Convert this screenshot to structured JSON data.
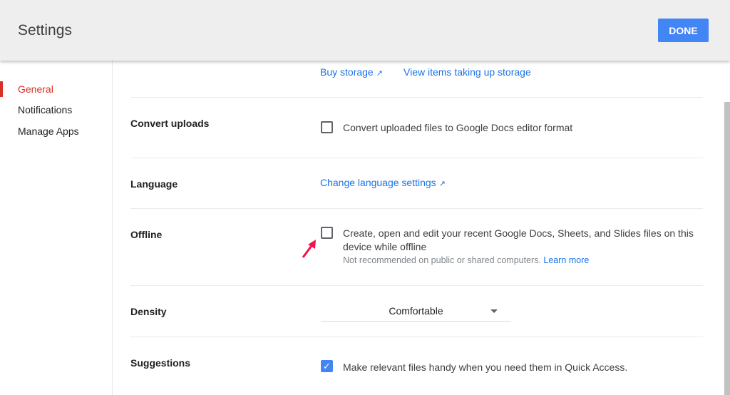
{
  "header": {
    "title": "Settings",
    "done_label": "DONE"
  },
  "sidebar": {
    "items": [
      {
        "label": "General",
        "active": true
      },
      {
        "label": "Notifications"
      },
      {
        "label": "Manage Apps"
      }
    ]
  },
  "storage": {
    "buy_label": "Buy storage",
    "view_label": "View items taking up storage"
  },
  "convert": {
    "label": "Convert uploads",
    "checkbox_text": "Convert uploaded files to Google Docs editor format",
    "checked": false
  },
  "language": {
    "label": "Language",
    "link": "Change language settings"
  },
  "offline": {
    "label": "Offline",
    "line1": "Create, open and edit your recent Google Docs, Sheets, and Slides files on this",
    "line2": "device while offline",
    "note": "Not recommended on public or shared computers.",
    "learn_more": "Learn more",
    "checked": false
  },
  "density": {
    "label": "Density",
    "value": "Comfortable"
  },
  "suggestions": {
    "label": "Suggestions",
    "checkbox_text": "Make relevant files handy when you need them in Quick Access.",
    "checked": true
  },
  "colors": {
    "accent": "#4285f4",
    "active_nav": "#d93025",
    "link": "#1a73e8",
    "annotation_arrow": "#f0134d"
  }
}
